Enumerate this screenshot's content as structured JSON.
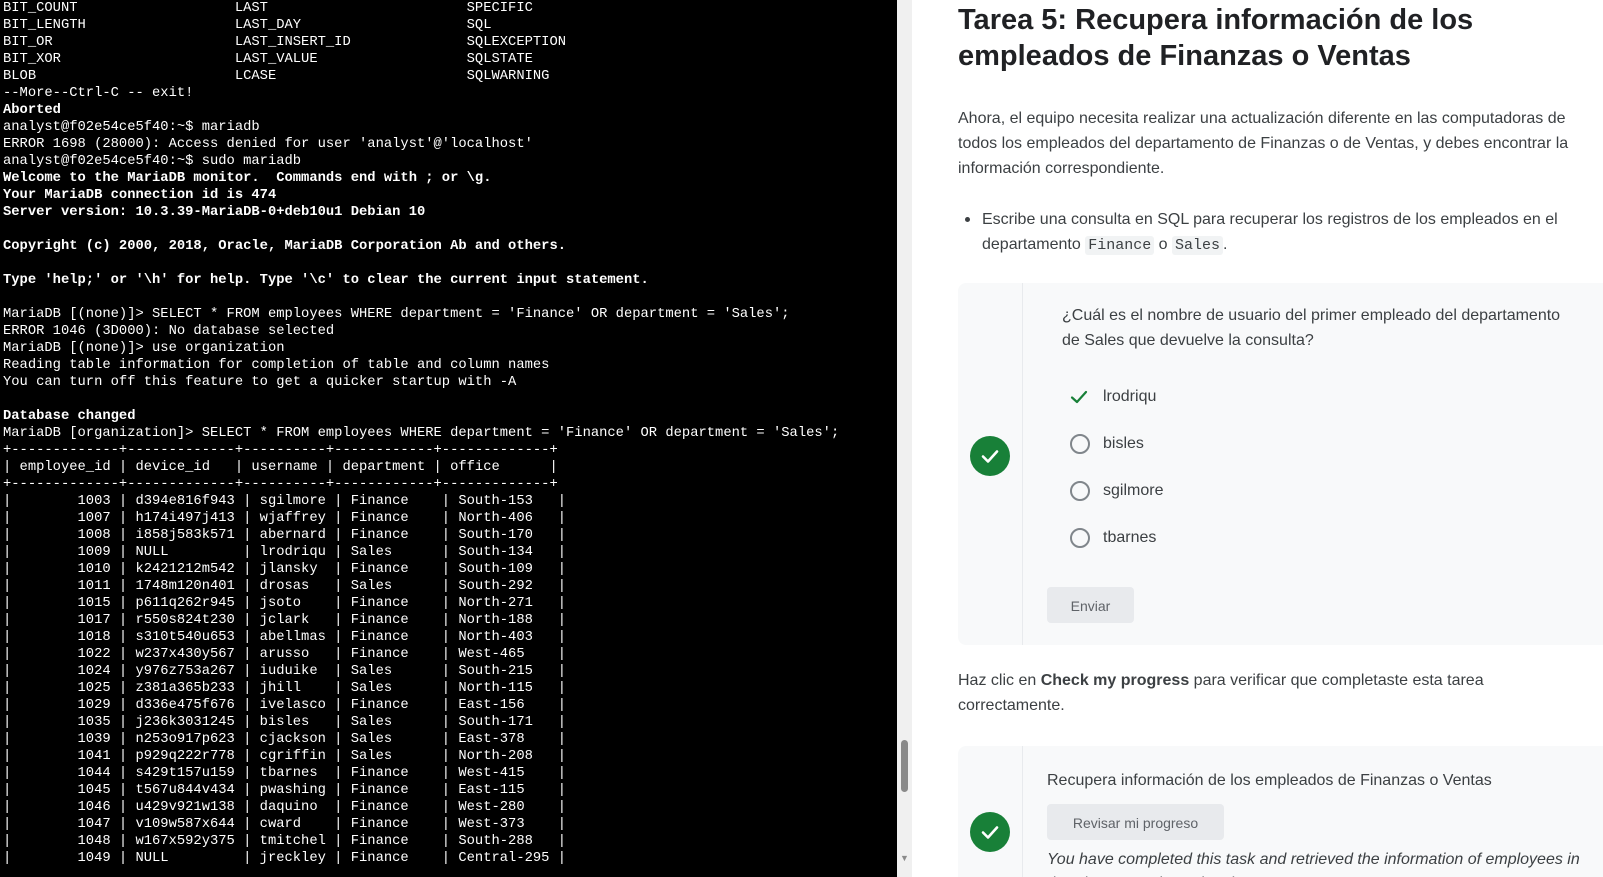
{
  "terminal": {
    "lines": [
      {
        "text": "BIT_COUNT                   LAST                        SPECIFIC",
        "bold": false
      },
      {
        "text": "BIT_LENGTH                  LAST_DAY                    SQL",
        "bold": false
      },
      {
        "text": "BIT_OR                      LAST_INSERT_ID              SQLEXCEPTION",
        "bold": false
      },
      {
        "text": "BIT_XOR                     LAST_VALUE                  SQLSTATE",
        "bold": false
      },
      {
        "text": "BLOB                        LCASE                       SQLWARNING",
        "bold": false
      },
      {
        "text": "--More--Ctrl-C -- exit!",
        "bold": false
      },
      {
        "text": "Aborted",
        "bold": true
      },
      {
        "text": "analyst@f02e54ce5f40:~$ mariadb",
        "bold": false
      },
      {
        "text": "ERROR 1698 (28000): Access denied for user 'analyst'@'localhost'",
        "bold": false
      },
      {
        "text": "analyst@f02e54ce5f40:~$ sudo mariadb",
        "bold": false
      },
      {
        "text": "Welcome to the MariaDB monitor.  Commands end with ; or \\g.",
        "bold": true
      },
      {
        "text": "Your MariaDB connection id is 474",
        "bold": true
      },
      {
        "text": "Server version: 10.3.39-MariaDB-0+deb10u1 Debian 10",
        "bold": true
      },
      {
        "text": "",
        "bold": false
      },
      {
        "text": "Copyright (c) 2000, 2018, Oracle, MariaDB Corporation Ab and others.",
        "bold": true
      },
      {
        "text": "",
        "bold": false
      },
      {
        "text": "Type 'help;' or '\\h' for help. Type '\\c' to clear the current input statement.",
        "bold": true
      },
      {
        "text": "",
        "bold": false
      },
      {
        "text": "MariaDB [(none)]> SELECT * FROM employees WHERE department = 'Finance' OR department = 'Sales';",
        "bold": false
      },
      {
        "text": "ERROR 1046 (3D000): No database selected",
        "bold": false
      },
      {
        "text": "MariaDB [(none)]> use organization",
        "bold": false
      },
      {
        "text": "Reading table information for completion of table and column names",
        "bold": false
      },
      {
        "text": "You can turn off this feature to get a quicker startup with -A",
        "bold": false
      },
      {
        "text": "",
        "bold": false
      },
      {
        "text": "Database changed",
        "bold": true
      },
      {
        "text": "MariaDB [organization]> SELECT * FROM employees WHERE department = 'Finance' OR department = 'Sales';",
        "bold": false
      },
      {
        "text": "+-------------+-------------+----------+------------+-------------+",
        "bold": false
      },
      {
        "text": "| employee_id | device_id   | username | department | office      |",
        "bold": false
      },
      {
        "text": "+-------------+-------------+----------+------------+-------------+",
        "bold": false
      },
      {
        "text": "|        1003 | d394e816f943 | sgilmore | Finance    | South-153   |",
        "bold": false
      },
      {
        "text": "|        1007 | h174i497j413 | wjaffrey | Finance    | North-406   |",
        "bold": false
      },
      {
        "text": "|        1008 | i858j583k571 | abernard | Finance    | South-170   |",
        "bold": false
      },
      {
        "text": "|        1009 | NULL         | lrodriqu | Sales      | South-134   |",
        "bold": false
      },
      {
        "text": "|        1010 | k2421212m542 | jlansky  | Finance    | South-109   |",
        "bold": false
      },
      {
        "text": "|        1011 | 1748m120n401 | drosas   | Sales      | South-292   |",
        "bold": false
      },
      {
        "text": "|        1015 | p611q262r945 | jsoto    | Finance    | North-271   |",
        "bold": false
      },
      {
        "text": "|        1017 | r550s824t230 | jclark   | Finance    | North-188   |",
        "bold": false
      },
      {
        "text": "|        1018 | s310t540u653 | abellmas | Finance    | North-403   |",
        "bold": false
      },
      {
        "text": "|        1022 | w237x430y567 | arusso   | Finance    | West-465    |",
        "bold": false
      },
      {
        "text": "|        1024 | y976z753a267 | iuduike  | Sales      | South-215   |",
        "bold": false
      },
      {
        "text": "|        1025 | z381a365b233 | jhill    | Sales      | North-115   |",
        "bold": false
      },
      {
        "text": "|        1029 | d336e475f676 | ivelasco | Finance    | East-156    |",
        "bold": false
      },
      {
        "text": "|        1035 | j236k3031245 | bisles   | Sales      | South-171   |",
        "bold": false
      },
      {
        "text": "|        1039 | n253o917p623 | cjackson | Sales      | East-378    |",
        "bold": false
      },
      {
        "text": "|        1041 | p929q222r778 | cgriffin | Sales      | North-208   |",
        "bold": false
      },
      {
        "text": "|        1044 | s429t157u159 | tbarnes  | Finance    | West-415    |",
        "bold": false
      },
      {
        "text": "|        1045 | t567u844v434 | pwashing | Finance    | East-115    |",
        "bold": false
      },
      {
        "text": "|        1046 | u429v921w138 | daquino  | Finance    | West-280    |",
        "bold": false
      },
      {
        "text": "|        1047 | v109w587x644 | cward    | Finance    | West-373    |",
        "bold": false
      },
      {
        "text": "|        1048 | w167x592y375 | tmitchel | Finance    | South-288   |",
        "bold": false
      },
      {
        "text": "|        1049 | NULL         | jreckley | Finance    | Central-295 |",
        "bold": false
      }
    ]
  },
  "lab": {
    "title": "Tarea 5: Recupera información de los empleados de Finanzas o Ventas",
    "intro": "Ahora, el equipo necesita realizar una actualización diferente en las computadoras de todos los empleados del departamento de Finanzas o de Ventas, y debes encontrar la información correspondiente.",
    "bullet": {
      "before": "Escribe una consulta en SQL para recuperar los registros de los empleados en el departamento ",
      "code1": "Finance",
      "middle": " o ",
      "code2": "Sales",
      "after": "."
    },
    "question": {
      "text": "¿Cuál es el nombre de usuario del primer empleado del departamento de Sales que devuelve la consulta?",
      "options": [
        {
          "label": "lrodriqu",
          "selected": true
        },
        {
          "label": "bisles",
          "selected": false
        },
        {
          "label": "sgilmore",
          "selected": false
        },
        {
          "label": "tbarnes",
          "selected": false
        }
      ],
      "submit_label": "Enviar",
      "status_color": "#188038"
    },
    "check": {
      "before": "Haz clic en ",
      "bold": "Check my progress",
      "after": " para verificar que completaste esta tarea correctamente."
    },
    "progress": {
      "title": "Recupera información de los empleados de Finanzas o Ventas",
      "button_label": "Revisar mi progreso",
      "message": "You have completed this task and retrieved the information of employees in the Finance or the Sales department."
    }
  }
}
